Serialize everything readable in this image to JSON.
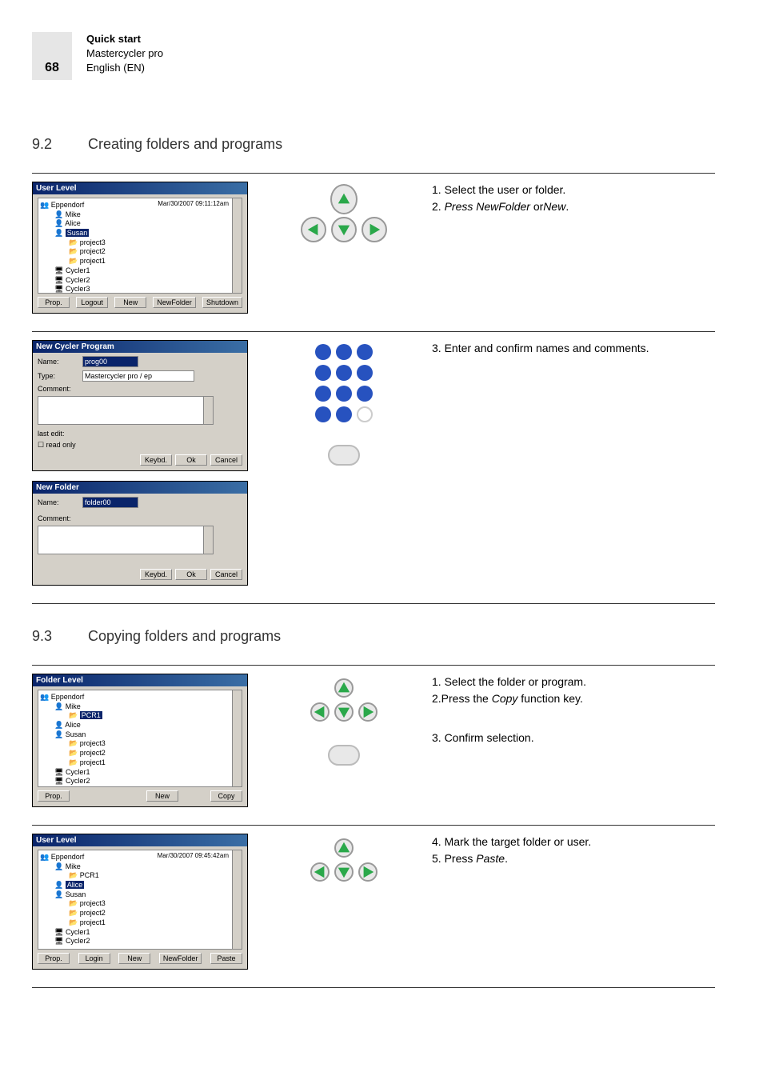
{
  "page_number": "68",
  "header": {
    "line1": "Quick start",
    "line2": "Mastercycler pro",
    "line3": "English (EN)"
  },
  "sec92": {
    "num": "9.2",
    "title": "Creating folders and programs"
  },
  "sec93": {
    "num": "9.3",
    "title": "Copying folders and programs"
  },
  "s92r1": {
    "t1": "1. Select the user or folder.",
    "t2a": "2. ",
    "t2b": "Press NewFolder ",
    "t2c": "or",
    "t2d": "New",
    "t2e": "."
  },
  "s92r2": {
    "t1": "3. Enter and confirm names and comments."
  },
  "s93r1": {
    "t1": "1. Select the folder or program.",
    "t2a": "2.Press the ",
    "t2b": "Copy",
    "t2c": " function key.",
    "t3": "3. Confirm selection."
  },
  "s93r2": {
    "t1": "4. Mark the target folder or user.",
    "t2a": "5. Press ",
    "t2b": "Paste",
    "t2c": "."
  },
  "dlg_userlevel": {
    "title": "User Level",
    "timestamp": "Mar/30/2007 09:11:12am",
    "root": "Eppendorf",
    "u1": "Mike",
    "u2": "Alice",
    "u3": "Susan",
    "f1": "project3",
    "f2": "project2",
    "f3": "project1",
    "c1": "Cycler1",
    "c2": "Cycler2",
    "c3": "Cycler3",
    "b1": "Prop.",
    "b2": "Logout",
    "b3": "New",
    "b4": "NewFolder",
    "b5": "Shutdown"
  },
  "dlg_newprog": {
    "title": "New Cycler Program",
    "name_l": "Name:",
    "name_v": "prog00",
    "type_l": "Type:",
    "type_v": "Mastercycler pro / ep",
    "comm_l": "Comment:",
    "last": "last edit:",
    "ro": "read only",
    "bk": "Keybd.",
    "bo": "Ok",
    "bc": "Cancel"
  },
  "dlg_newfolder": {
    "title": "New Folder",
    "name_l": "Name:",
    "name_v": "folder00",
    "comm_l": "Comment:",
    "bk": "Keybd.",
    "bo": "Ok",
    "bc": "Cancel"
  },
  "dlg_folderlevel": {
    "title": "Folder Level",
    "root": "Eppendorf",
    "u1": "Mike",
    "fp": "PCR1",
    "u2": "Alice",
    "u3": "Susan",
    "f1": "project3",
    "f2": "project2",
    "f3": "project1",
    "c1": "Cycler1",
    "c2": "Cycler2",
    "b1": "Prop.",
    "b2": "New",
    "b3": "Copy"
  },
  "dlg_userlevel2": {
    "title": "User Level",
    "timestamp": "Mar/30/2007 09:45:42am",
    "root": "Eppendorf",
    "u1": "Mike",
    "fp": "PCR1",
    "u2": "Alice",
    "u3": "Susan",
    "f1": "project3",
    "f2": "project2",
    "f3": "project1",
    "c1": "Cycler1",
    "c2": "Cycler2",
    "b1": "Prop.",
    "b2": "Login",
    "b3": "New",
    "b4": "NewFolder",
    "b5": "Paste"
  }
}
